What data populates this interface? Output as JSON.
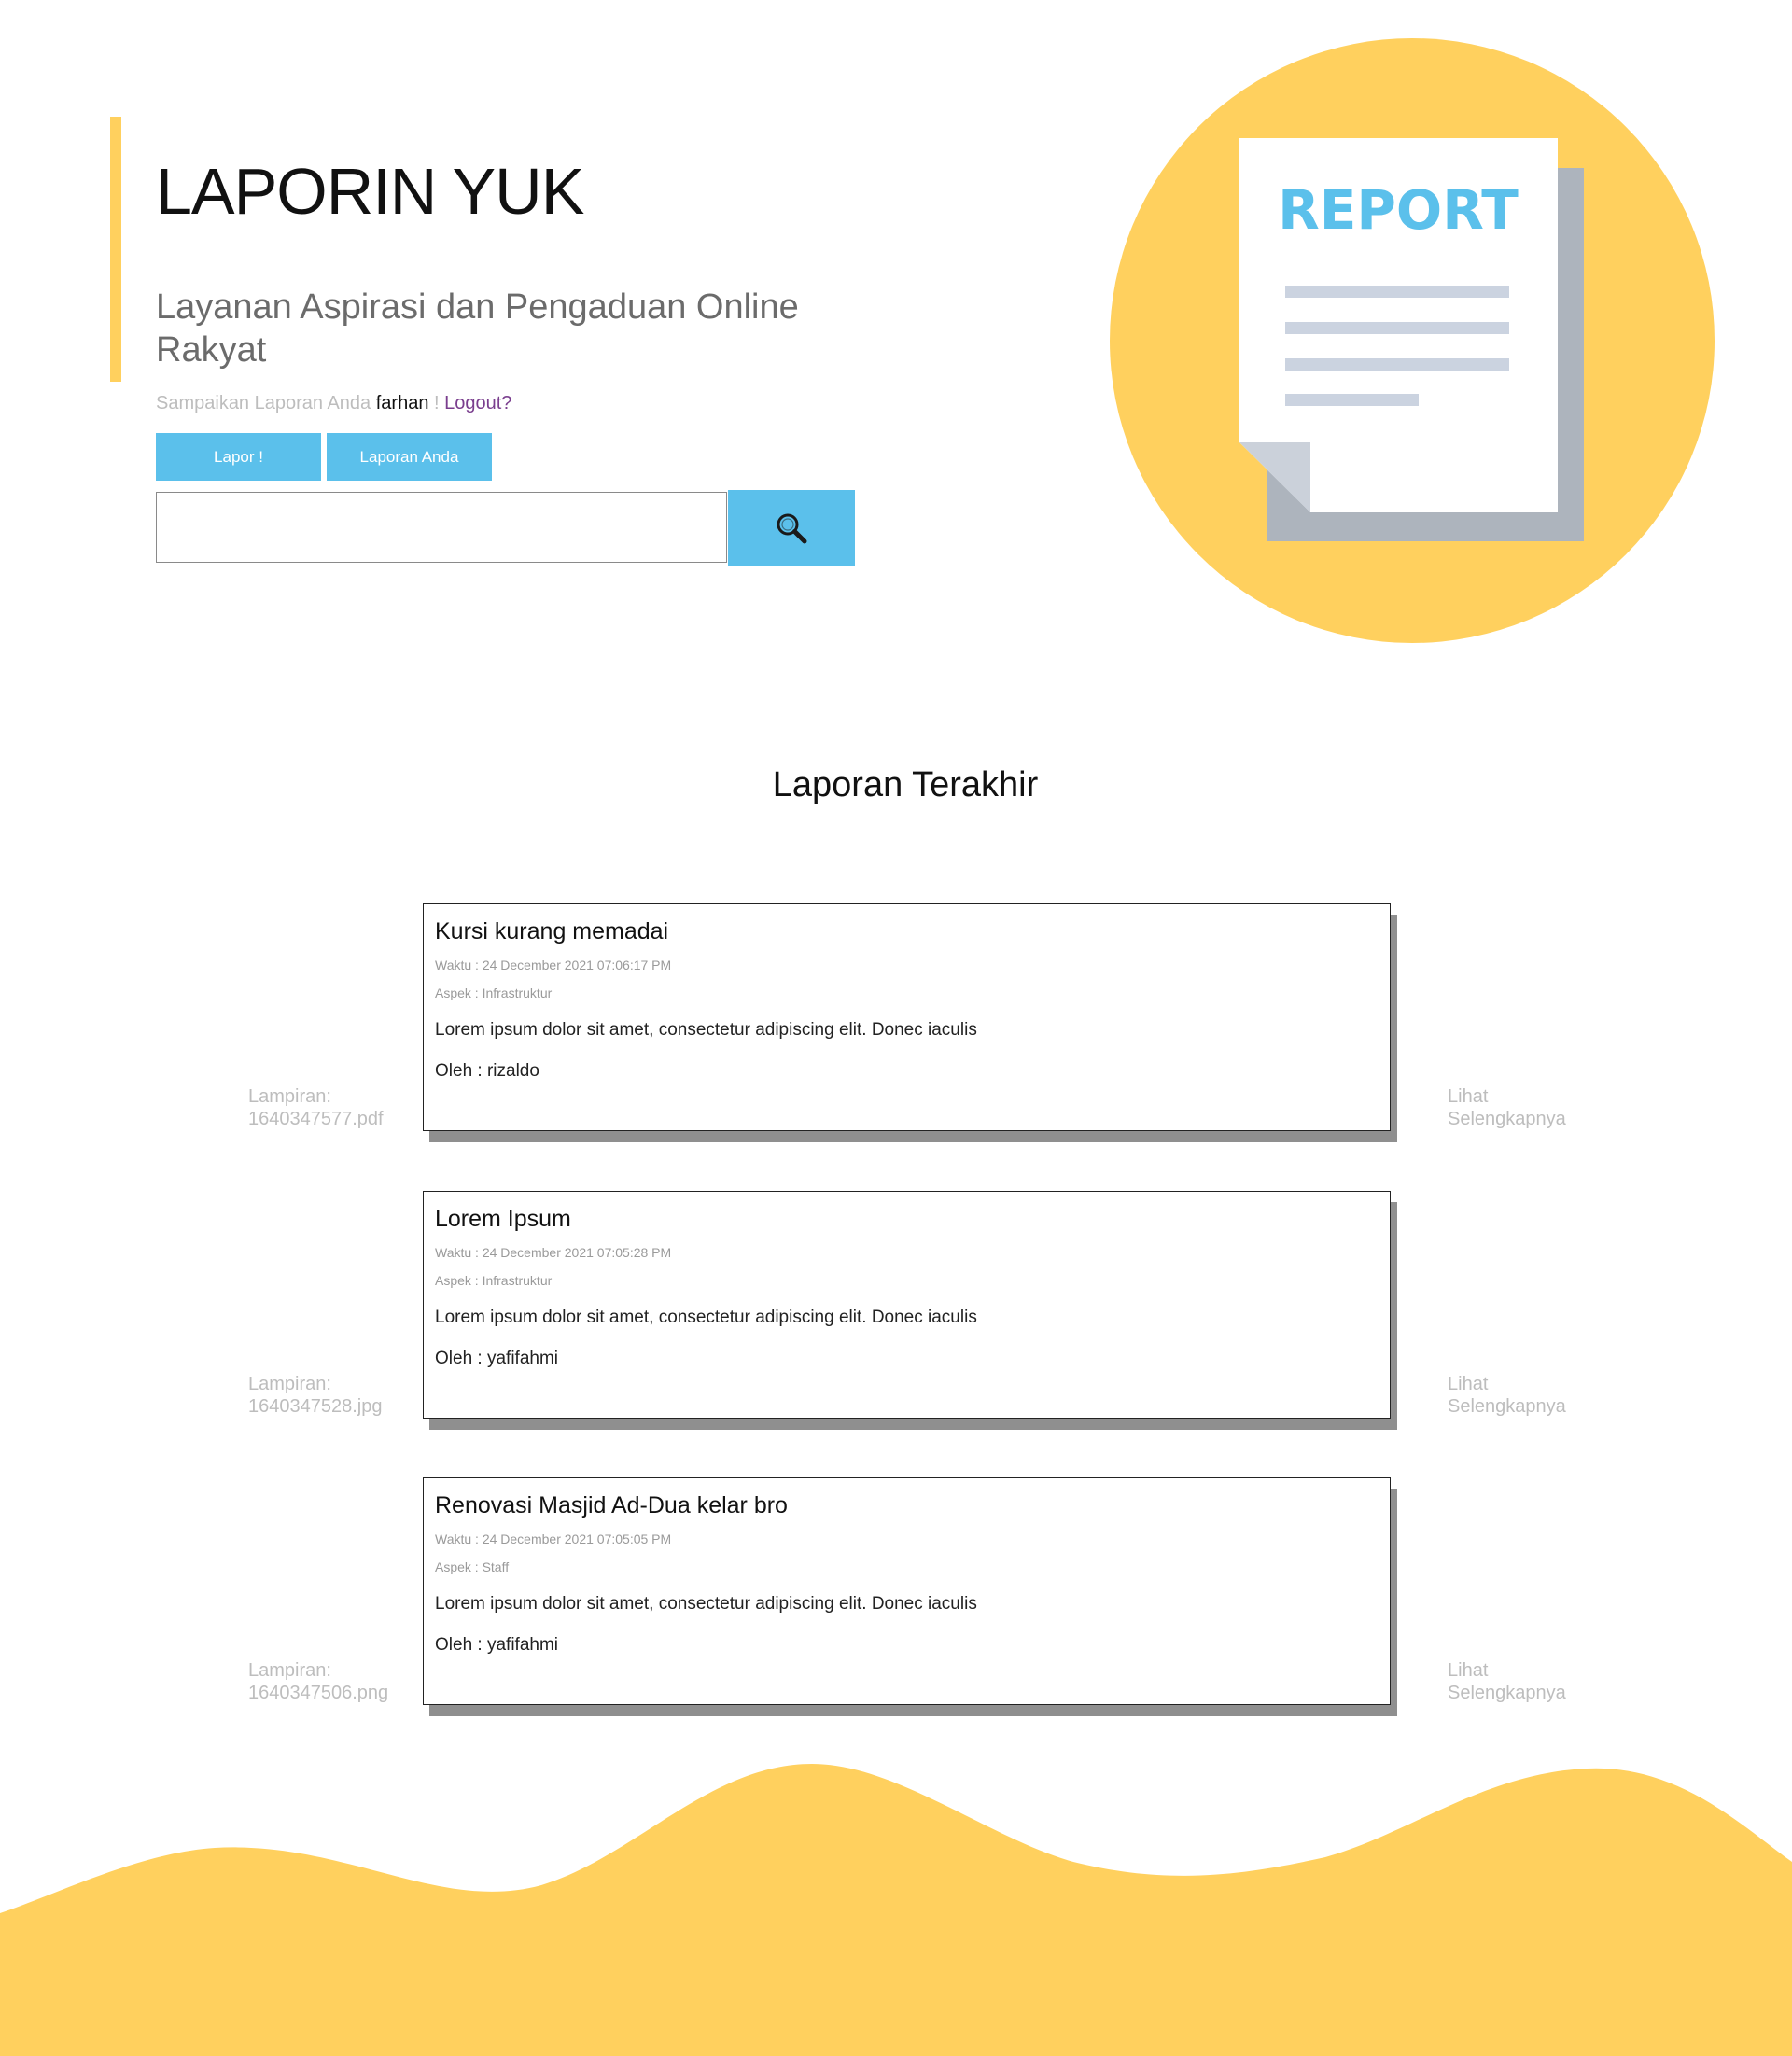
{
  "hero": {
    "title": "LAPORIN YUK",
    "subtitle": "Layanan Aspirasi dan Pengaduan Online Rakyat",
    "greeting_prefix": "Sampaikan Laporan Anda ",
    "username": "farhan",
    "greeting_mid": " ! ",
    "logout_label": "Logout?",
    "report_button_label": "Lapor !",
    "my_reports_button_label": "Laporan Anda",
    "search_value": "",
    "search_icon": "search-icon"
  },
  "illustration": {
    "text": "REPORT",
    "circle_color": "#ffd05e",
    "text_color": "#5bc0eb"
  },
  "section": {
    "title": "Laporan Terakhir"
  },
  "reports": [
    {
      "title": "Kursi kurang memadai",
      "time": "Waktu : 24 December 2021 07:06:17 PM",
      "aspect": "Aspek : Infrastruktur",
      "body": "Lorem ipsum dolor sit amet, consectetur adipiscing elit. Donec iaculis",
      "author": "Oleh : rizaldo",
      "attachment_label": "Lampiran:",
      "attachment_file": "1640347577.pdf",
      "more_line1": "Lihat",
      "more_line2": "Selengkapnya"
    },
    {
      "title": "Lorem Ipsum",
      "time": "Waktu : 24 December 2021 07:05:28 PM",
      "aspect": "Aspek : Infrastruktur",
      "body": "Lorem ipsum dolor sit amet, consectetur adipiscing elit. Donec iaculis",
      "author": "Oleh : yafifahmi",
      "attachment_label": "Lampiran:",
      "attachment_file": "1640347528.jpg",
      "more_line1": "Lihat",
      "more_line2": "Selengkapnya"
    },
    {
      "title": "Renovasi Masjid Ad-Dua kelar bro",
      "time": "Waktu : 24 December 2021 07:05:05 PM",
      "aspect": "Aspek : Staff",
      "body": "Lorem ipsum dolor sit amet, consectetur adipiscing elit. Donec iaculis",
      "author": "Oleh : yafifahmi",
      "attachment_label": "Lampiran:",
      "attachment_file": "1640347506.png",
      "more_line1": "Lihat",
      "more_line2": "Selengkapnya"
    }
  ],
  "colors": {
    "accent_yellow": "#ffd05e",
    "accent_blue": "#5bc0eb",
    "muted_text": "#bdbdbd",
    "logout_purple": "#7a3e8e"
  }
}
